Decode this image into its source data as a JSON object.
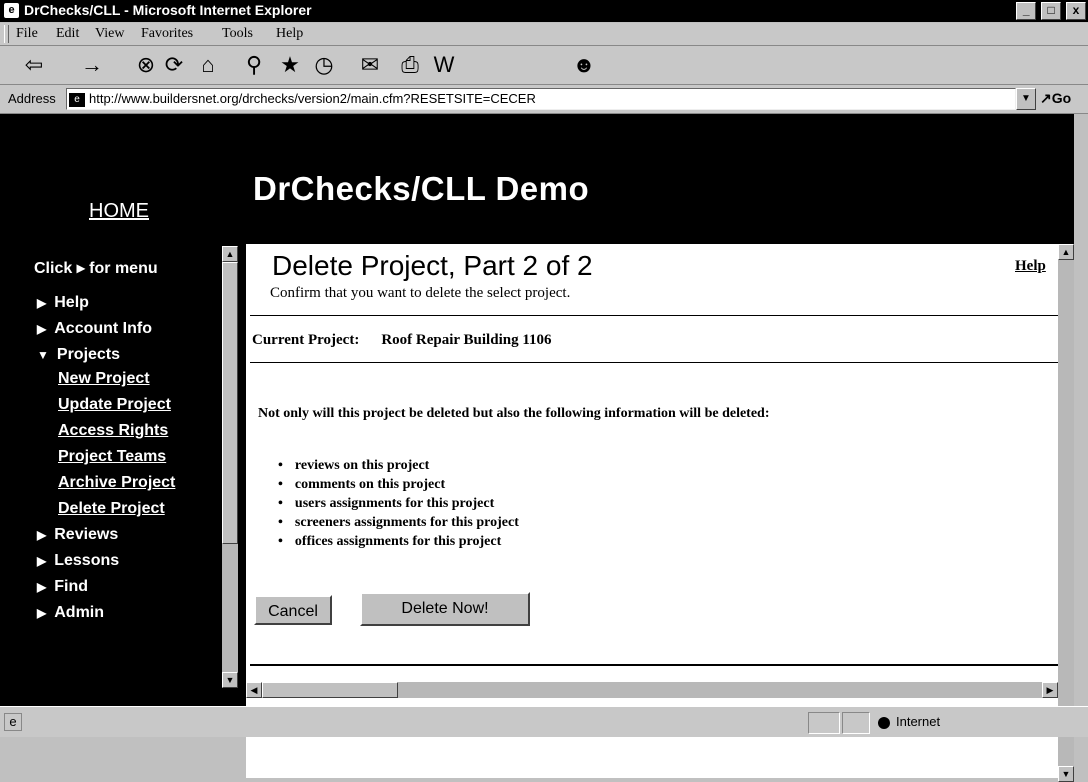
{
  "window": {
    "title": "DrChecks/CLL - Microsoft Internet Explorer",
    "controls": [
      "_",
      "□",
      "x"
    ]
  },
  "menu": {
    "items": [
      "File",
      "Edit",
      "View",
      "Favorites",
      "Tools",
      "Help"
    ]
  },
  "toolbar": {
    "icons": [
      "back-icon",
      "forward-icon",
      "stop-icon",
      "refresh-icon",
      "home-icon",
      "search-icon",
      "favorites-icon",
      "history-icon",
      "mail-icon",
      "print-icon",
      "edit-icon",
      "messenger-icon"
    ]
  },
  "address": {
    "label": "Address",
    "url": "http://www.buildersnet.org/drchecks/version2/main.cfm?RESETSITE=CECER",
    "go_label": "Go"
  },
  "site": {
    "home_label": "HOME",
    "brand": "DrChecks/CLL Demo"
  },
  "sidebar": {
    "hint": "Click ▸ for menu",
    "items": [
      {
        "label": "Help"
      },
      {
        "label": "Account Info"
      },
      {
        "label": "Projects"
      },
      {
        "label": "Reviews"
      },
      {
        "label": "Lessons"
      },
      {
        "label": "Find"
      },
      {
        "label": "Admin"
      }
    ],
    "project_sub": [
      "New Project",
      "Update Project",
      "Access Rights",
      "Project Teams",
      "Archive Project",
      "Delete Project"
    ]
  },
  "main": {
    "heading": "Delete Project, Part 2 of 2",
    "help_link": "Help",
    "subtitle": "Confirm that you want to delete the select project.",
    "current_project_label": "Current Project:",
    "current_project_value": "Roof Repair Building 1106",
    "warning": "Not only will this project be deleted but also the following information will be deleted:",
    "bullets": [
      "reviews on this project",
      "comments on this project",
      "users assignments for this project",
      "screeners assignments for this project",
      "offices assignments for this project"
    ],
    "cancel_label": "Cancel",
    "delete_label": "Delete Now!"
  },
  "status": {
    "zone": "Internet"
  }
}
